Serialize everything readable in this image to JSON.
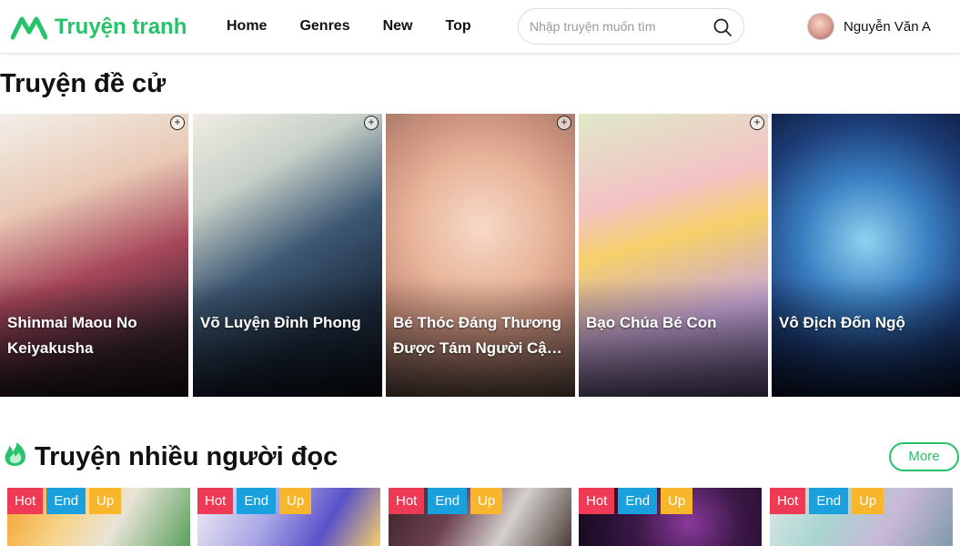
{
  "header": {
    "logo_text": "Truyện tranh",
    "nav": [
      "Home",
      "Genres",
      "New",
      "Top"
    ],
    "search_placeholder": "Nhập truyện muốn tìm",
    "user_name": "Nguyễn Văn A"
  },
  "recommended": {
    "title": "Truyện đề cử",
    "items": [
      {
        "title": "Shinmai Maou No Keiyakusha"
      },
      {
        "title": "Võ Luyện Đỉnh Phong"
      },
      {
        "title": "Bé Thóc Đáng Thương Được Tám Người Cậu Tranh Sủng"
      },
      {
        "title": "Bạo Chúa Bé Con"
      },
      {
        "title": "Vô Địch Đốn Ngộ"
      }
    ]
  },
  "popular": {
    "title": "Truyện nhiều người đọc",
    "more_label": "More",
    "badges": {
      "hot": "Hot",
      "end": "End",
      "up": "Up"
    },
    "count": 5
  },
  "colors": {
    "brand": "#27c36a",
    "hot": "#ee3a55",
    "end": "#1aa0dd",
    "up": "#f7b62c"
  }
}
